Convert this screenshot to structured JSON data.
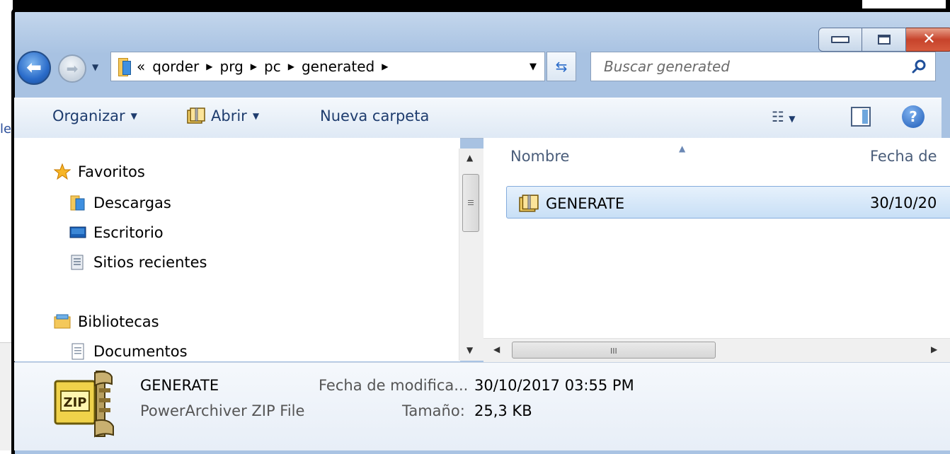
{
  "background": {
    "left_fragment_text": "le"
  },
  "window": {
    "title_buttons": {
      "minimize": "minimize",
      "maximize": "maximize",
      "close": "✕"
    }
  },
  "nav": {
    "address_prefix": "«",
    "breadcrumbs": [
      "qorder",
      "prg",
      "pc",
      "generated"
    ],
    "search_placeholder": "Buscar generated"
  },
  "toolbar": {
    "organize": "Organizar",
    "open": "Abrir",
    "new_folder": "Nueva carpeta"
  },
  "navpane": {
    "favorites": "Favoritos",
    "downloads": "Descargas",
    "desktop": "Escritorio",
    "recent": "Sitios recientes",
    "libraries": "Bibliotecas",
    "documents": "Documentos"
  },
  "content": {
    "columns": {
      "name": "Nombre",
      "date": "Fecha de"
    },
    "rows": [
      {
        "name": "GENERATE",
        "date": "30/10/20"
      }
    ],
    "hscroll_grip": "III"
  },
  "details": {
    "name": "GENERATE",
    "type": "PowerArchiver ZIP File",
    "modified_label": "Fecha de modifica...",
    "modified_value": "30/10/2017 03:55 PM",
    "size_label": "Tamaño:",
    "size_value": "25,3 KB"
  },
  "colors": {
    "window_frame": "#a9c3e3",
    "selection": "#c8dff6",
    "close_button": "#c7432b",
    "toolbar_text": "#1e3c6e"
  }
}
